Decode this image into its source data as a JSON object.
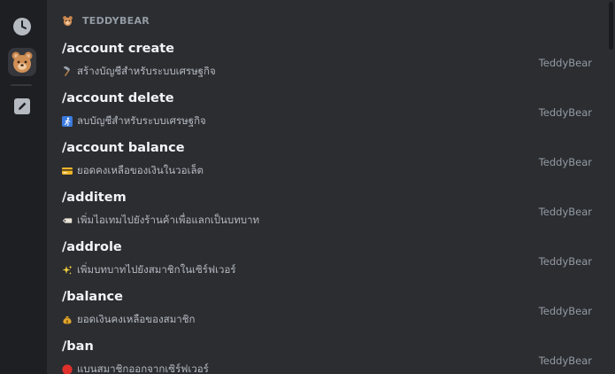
{
  "rail": {
    "items": [
      {
        "name": "recent-icon"
      },
      {
        "name": "teddybear-app-icon",
        "active": true
      },
      {
        "name": "edit-icon"
      }
    ]
  },
  "section": {
    "title": "TEDDYBEAR",
    "icon": "teddybear-icon"
  },
  "commands": [
    {
      "name": "/account create",
      "icon": "hammer-icon",
      "description": "สร้างบัญชีสำหรับระบบเศรษฐกิจ",
      "source": "TeddyBear"
    },
    {
      "name": "/account delete",
      "icon": "person-running-exit-icon",
      "description": "ลบบัญชีสำหรับระบบเศรษฐกิจ",
      "source": "TeddyBear"
    },
    {
      "name": "/account balance",
      "icon": "credit-card-icon",
      "description": "ยอดคงเหลือของเงินในวอเล็ต",
      "source": "TeddyBear"
    },
    {
      "name": "/additem",
      "icon": "price-tag-icon",
      "description": "เพิ่มไอเทมไปยังร้านค้าเพื่อแลกเป็นบทบาท",
      "source": "TeddyBear"
    },
    {
      "name": "/addrole",
      "icon": "sparkles-icon",
      "description": "เพิ่มบทบาทไปยังสมาชิกในเซิร์ฟเวอร์",
      "source": "TeddyBear"
    },
    {
      "name": "/balance",
      "icon": "money-bag-icon",
      "description": "ยอดเงินคงเหลือของสมาชิก",
      "source": "TeddyBear"
    },
    {
      "name": "/ban",
      "icon": "red-circle-icon",
      "description": "แบนสมาชิกออกจากเซิร์ฟเวอร์",
      "source": "TeddyBear"
    }
  ],
  "colors": {
    "background": "#2b2d31",
    "rail": "#1e1f22",
    "command_name": "#f2f3f5",
    "description": "#b5bac1",
    "muted": "#949ba4"
  }
}
